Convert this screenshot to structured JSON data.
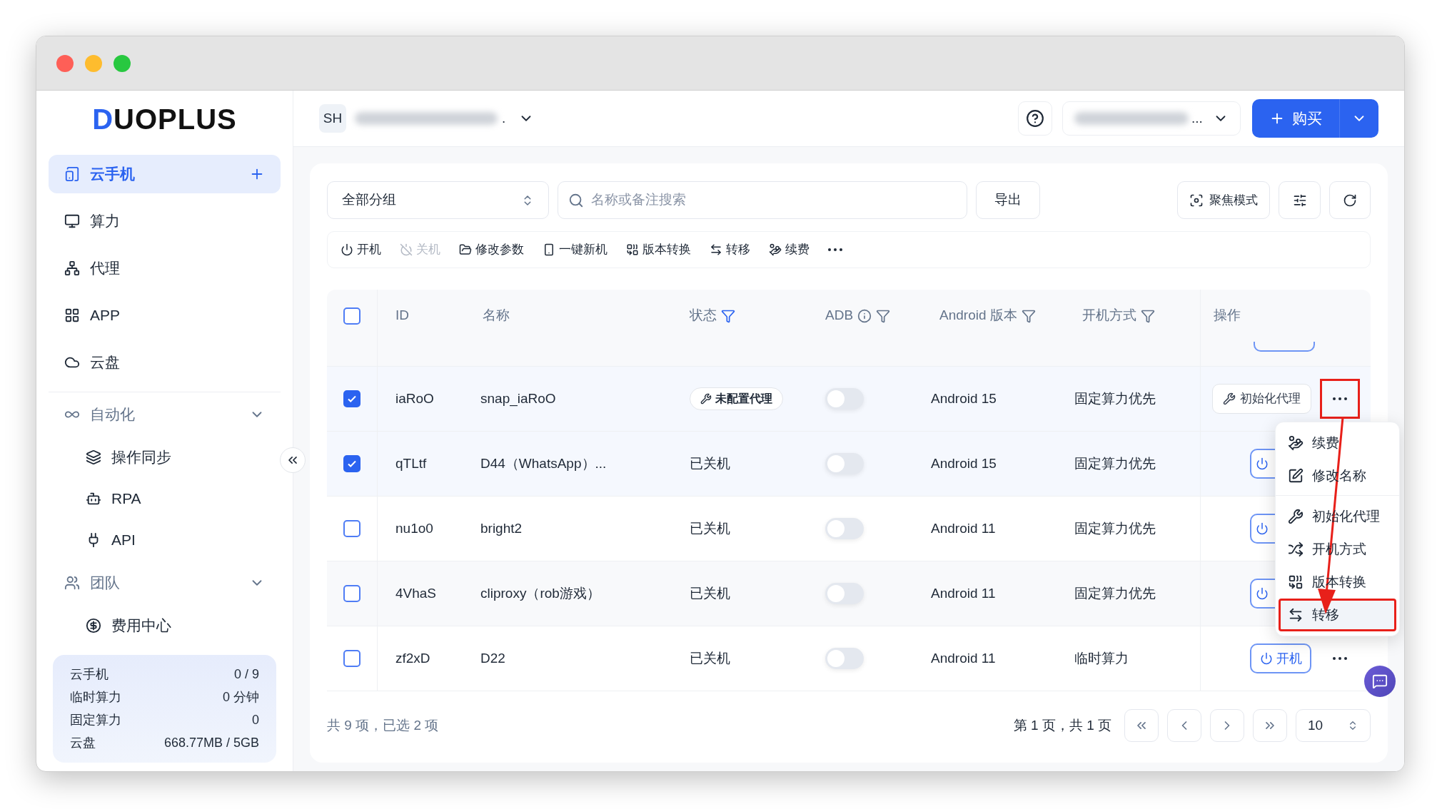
{
  "sidebar": {
    "logo": "DUOPLUS",
    "nav": [
      {
        "label": "云手机",
        "selected": true
      },
      {
        "label": "算力",
        "selected": false
      },
      {
        "label": "代理",
        "selected": false
      },
      {
        "label": "APP",
        "selected": false
      },
      {
        "label": "云盘",
        "selected": false
      }
    ],
    "groups": [
      {
        "label": "自动化",
        "expanded": true,
        "children": [
          {
            "label": "操作同步"
          },
          {
            "label": "RPA"
          },
          {
            "label": "API"
          }
        ]
      },
      {
        "label": "团队",
        "expanded": true,
        "children": [
          {
            "label": "费用中心"
          }
        ]
      }
    ],
    "stats": [
      {
        "label": "云手机",
        "value": "0 / 9"
      },
      {
        "label": "临时算力",
        "value": "0 分钟"
      },
      {
        "label": "固定算力",
        "value": "0"
      },
      {
        "label": "云盘",
        "value": "668.77MB / 5GB"
      }
    ]
  },
  "header": {
    "workspace": {
      "avatar": "SH",
      "name_tail": "."
    },
    "account": {
      "name_tail": "..."
    },
    "buy_button": "购买"
  },
  "filters": {
    "group": "全部分组",
    "search": {
      "placeholder": "名称或备注搜索"
    },
    "export": "导出",
    "focus_mode": "聚焦模式"
  },
  "toolbar": [
    {
      "label": "开机",
      "disabled": false
    },
    {
      "label": "关机",
      "disabled": true
    },
    {
      "label": "修改参数",
      "disabled": false
    },
    {
      "label": "一键新机",
      "disabled": false
    },
    {
      "label": "版本转换",
      "disabled": false
    },
    {
      "label": "转移",
      "disabled": false
    },
    {
      "label": "续费",
      "disabled": false
    }
  ],
  "table": {
    "all_selected": false,
    "columns": [
      {
        "label": "ID"
      },
      {
        "label": "名称"
      },
      {
        "label": "状态",
        "filter_active": true
      },
      {
        "label": "ADB",
        "info": true,
        "filter_active": false
      },
      {
        "label": "Android 版本",
        "filter_active": false
      },
      {
        "label": "开机方式",
        "filter_active": false
      },
      {
        "label": "操作"
      }
    ],
    "rows": [
      {
        "selected": true,
        "id": "iaRoO",
        "name": "snap_iaRoO",
        "status": {
          "kind": "badge",
          "text": "未配置代理"
        },
        "adb_on": false,
        "android": "Android 15",
        "boot_mode": "固定算力优先",
        "action": {
          "kind": "init_proxy",
          "label": "初始化代理"
        },
        "more_button": {
          "highlighted": true
        }
      },
      {
        "selected": true,
        "id": "qTLtf",
        "name": "D44（WhatsApp）...",
        "status": {
          "kind": "text",
          "text": "已关机"
        },
        "adb_on": false,
        "android": "Android 15",
        "boot_mode": "固定算力优先",
        "action": {
          "kind": "power_on"
        }
      },
      {
        "selected": false,
        "id": "nu1o0",
        "name": "bright2",
        "status": {
          "kind": "text",
          "text": "已关机"
        },
        "adb_on": false,
        "android": "Android 11",
        "boot_mode": "固定算力优先",
        "action": {
          "kind": "power_on"
        }
      },
      {
        "selected": false,
        "id": "4VhaS",
        "name": "cliproxy（rob游戏）",
        "status": {
          "kind": "text",
          "text": "已关机"
        },
        "adb_on": false,
        "android": "Android 11",
        "boot_mode": "固定算力优先",
        "action": {
          "kind": "power_on"
        }
      },
      {
        "selected": false,
        "id": "zf2xD",
        "name": "D22",
        "status": {
          "kind": "text",
          "text": "已关机"
        },
        "adb_on": false,
        "android": "Android 11",
        "boot_mode": "临时算力",
        "action": {
          "kind": "power_on",
          "label": "开机"
        },
        "more_button": {
          "highlighted": false
        }
      }
    ]
  },
  "menu": {
    "groups": [
      {
        "items": [
          {
            "label": "续费",
            "selected": false,
            "highlighted": false
          },
          {
            "label": "修改名称",
            "selected": false,
            "highlighted": false
          }
        ]
      },
      {
        "items": [
          {
            "label": "初始化代理",
            "selected": false,
            "highlighted": false
          },
          {
            "label": "开机方式",
            "selected": false,
            "highlighted": false
          },
          {
            "label": "版本转换",
            "selected": false,
            "highlighted": false
          },
          {
            "label": "转移",
            "selected": true,
            "highlighted": true
          }
        ]
      }
    ]
  },
  "footer": {
    "summary": "共 9 项，已选 2 项",
    "page_info": "第 1 页，共 1 页",
    "page_size": "10"
  },
  "annotations": {
    "arrow": true
  }
}
